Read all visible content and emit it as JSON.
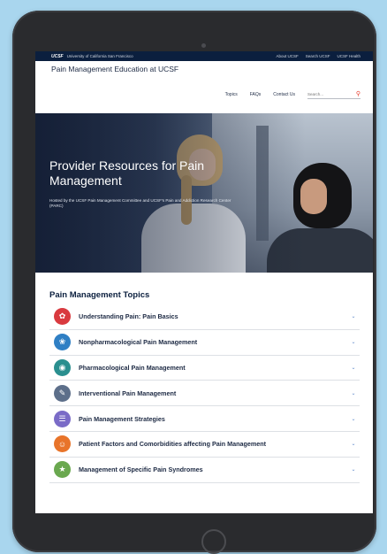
{
  "topbar": {
    "logo": "UCSF",
    "university": "University of California San Francisco",
    "links": [
      "About UCSF",
      "Search UCSF",
      "UCSF Health"
    ]
  },
  "site": {
    "title": "Pain Management Education at UCSF"
  },
  "nav": {
    "items": [
      "Topics",
      "FAQs",
      "Contact Us"
    ],
    "search_placeholder": "Search..."
  },
  "hero": {
    "title": "Provider Resources for Pain Management",
    "subtitle": "Hosted by the UCSF Pain Management Committee and UCSF's Pain and Addiction Research Center (PARC)"
  },
  "topics": {
    "heading": "Pain Management Topics",
    "items": [
      {
        "label": "Understanding Pain: Pain Basics",
        "icon": "pain-basics-icon",
        "color": "#d93a3f"
      },
      {
        "label": "Nonpharmacological Pain Management",
        "icon": "butterfly-icon",
        "color": "#2f7fc4"
      },
      {
        "label": "Pharmacological Pain Management",
        "icon": "pills-icon",
        "color": "#2a8f8f"
      },
      {
        "label": "Interventional Pain Management",
        "icon": "syringe-icon",
        "color": "#5d6f8a"
      },
      {
        "label": "Pain Management Strategies",
        "icon": "strategy-icon",
        "color": "#7a6bc7"
      },
      {
        "label": "Patient Factors and Comorbidities affecting Pain Management",
        "icon": "patient-icon",
        "color": "#e8742a"
      },
      {
        "label": "Management of Specific Pain Syndromes",
        "icon": "syndrome-icon",
        "color": "#6aa84f"
      }
    ]
  },
  "colors": {
    "background": "#a9d6ee",
    "topbar": "#0b1f3e",
    "accent": "#e63a2b",
    "chevron": "#5b86c9"
  }
}
